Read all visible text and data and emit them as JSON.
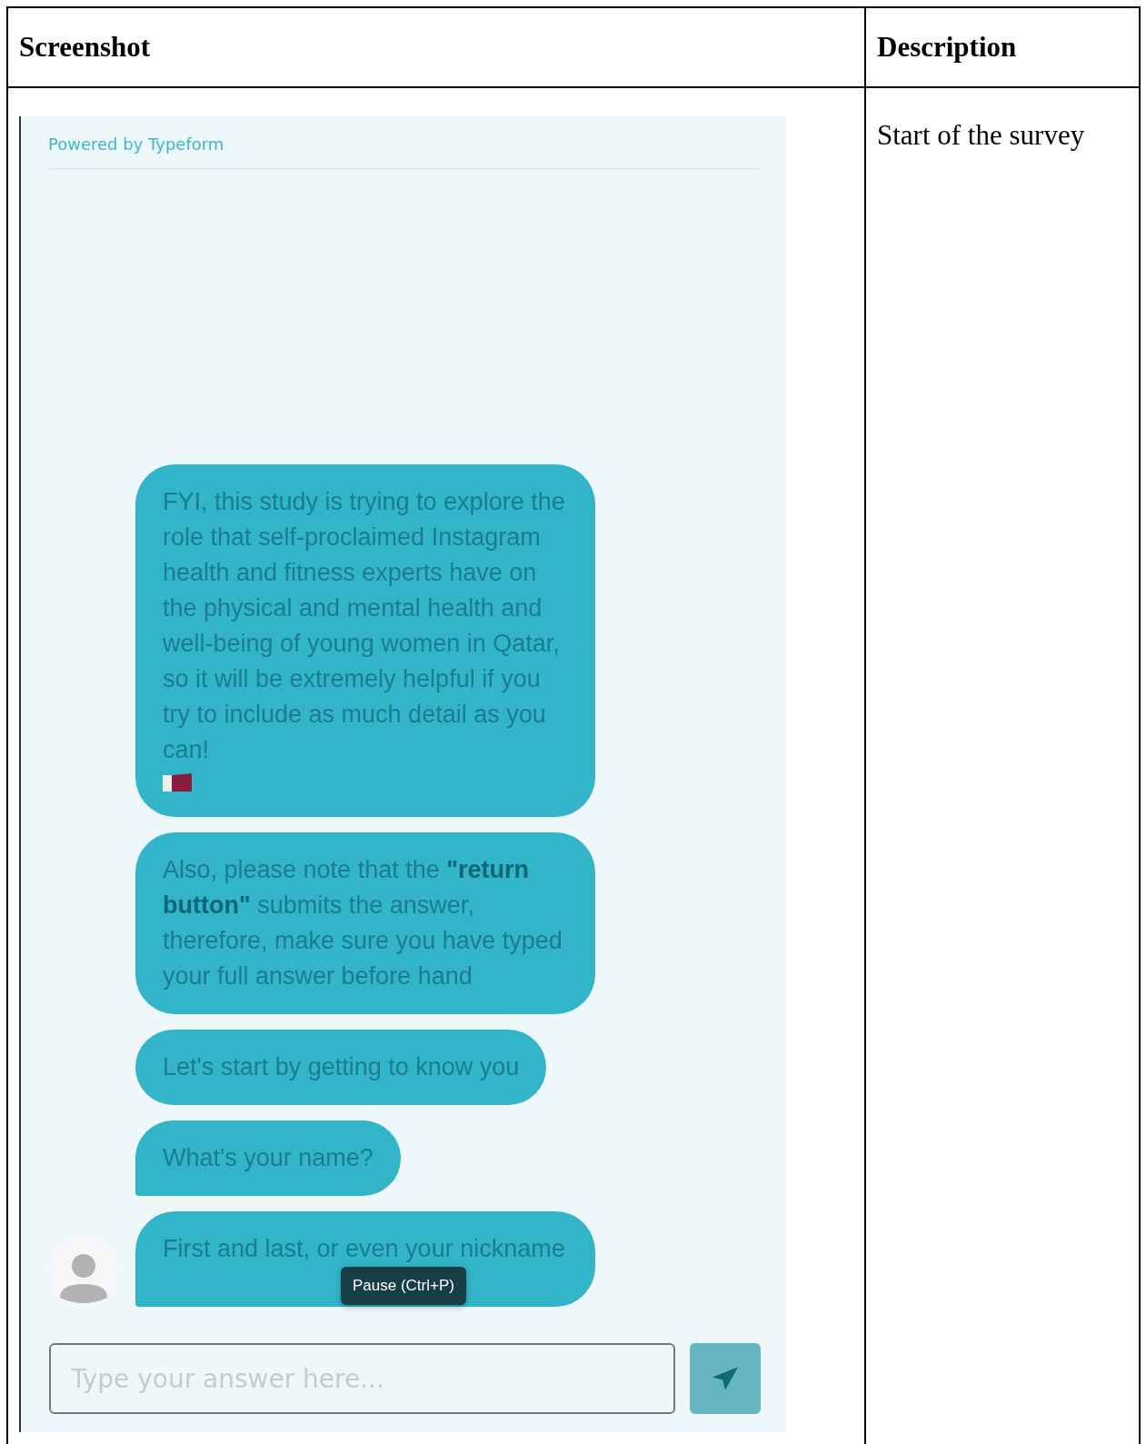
{
  "table": {
    "columns": [
      "Screenshot",
      "Description"
    ],
    "rows": [
      {
        "screenshot": {
          "powered_by": "Powered by Typeform",
          "messages": [
            {
              "text": "FYI, this study is trying to explore the role that self-proclaimed Instagram health and fitness experts have on the physical and mental health and well-being of young women in Qatar, so it will be extremely helpful if you try to include as much detail as you can!",
              "flag": true,
              "tail": false
            },
            {
              "text": "Also, please note that the **\"return button\"** submits the answer, therefore, make sure you have typed your full answer before hand",
              "flag": false,
              "tail": false
            },
            {
              "text": "Let's start by getting to know you",
              "flag": false,
              "tail": false
            },
            {
              "text": "What's your name?",
              "flag": false,
              "tail": true
            },
            {
              "text": "First and last, or even your nickname",
              "flag": false,
              "tail": true,
              "avatar": true
            }
          ],
          "tooltip": "Pause (Ctrl+P)",
          "input": {
            "placeholder": "Type your answer here..."
          }
        },
        "description": "Start of the survey"
      }
    ]
  }
}
